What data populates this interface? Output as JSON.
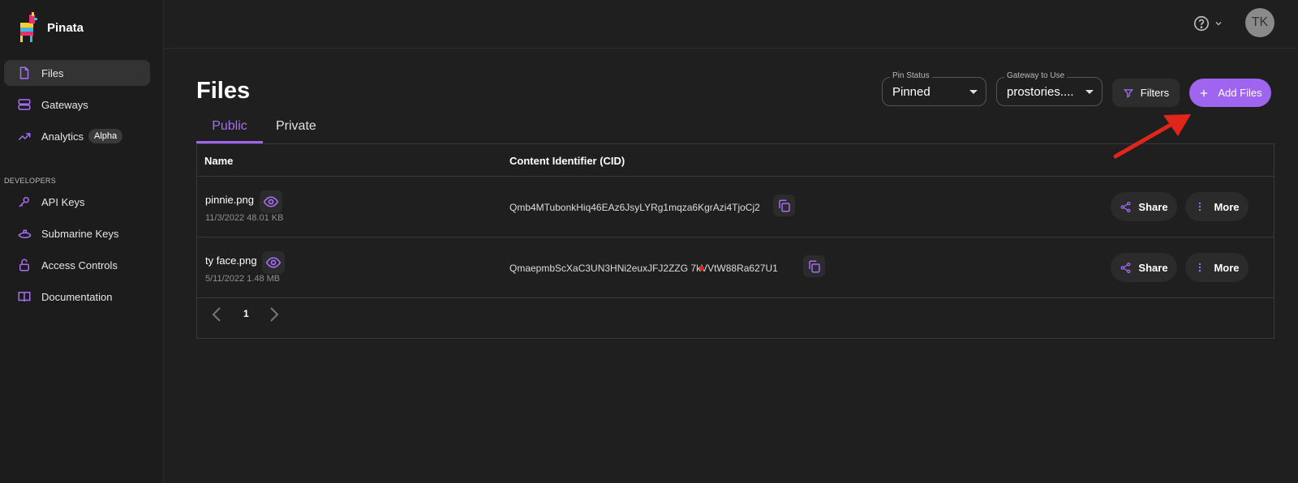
{
  "app": {
    "name": "Pinata"
  },
  "sidebar": {
    "items": [
      {
        "label": "Files",
        "icon": "file-icon",
        "active": true
      },
      {
        "label": "Gateways",
        "icon": "server-icon"
      },
      {
        "label": "Analytics",
        "icon": "trending-up-icon",
        "badge": "Alpha"
      }
    ],
    "section_label": "DEVELOPERS",
    "dev_items": [
      {
        "label": "API Keys",
        "icon": "key-icon"
      },
      {
        "label": "Submarine Keys",
        "icon": "submarine-icon"
      },
      {
        "label": "Access Controls",
        "icon": "lock-icon"
      },
      {
        "label": "Documentation",
        "icon": "book-icon"
      }
    ]
  },
  "topbar": {
    "avatar_initials": "TK",
    "help_icon": "help-circle-icon"
  },
  "main": {
    "title": "Files",
    "pin_status": {
      "legend": "Pin Status",
      "value": "Pinned"
    },
    "gateway": {
      "legend": "Gateway to Use",
      "value": "prostories...."
    },
    "filters_label": "Filters",
    "add_files_label": "Add Files",
    "tabs": [
      {
        "label": "Public",
        "active": true
      },
      {
        "label": "Private"
      }
    ],
    "table": {
      "headers": {
        "name": "Name",
        "cid": "Content Identifier (CID)"
      },
      "rows": [
        {
          "name": "pinnie.png",
          "meta": "11/3/2022 48.01 KB",
          "cid": "Qmb4MTubonkHiq46EAz6JsyLYRg1mqza6KgrAzi4TjoCj2",
          "share": "Share",
          "more": "More"
        },
        {
          "name": "ty face.png",
          "meta": "5/11/2022 1.48 MB",
          "cid": "QmaepmbScXaC3UN3HNi2euxJFJ2ZZG 7kVVtW88Ra627U1",
          "share": "Share",
          "more": "More"
        }
      ]
    },
    "pagination": {
      "page": "1"
    }
  },
  "colors": {
    "accent": "#a065f0",
    "background": "#1f1f1f",
    "annotation": "#e0261b"
  }
}
